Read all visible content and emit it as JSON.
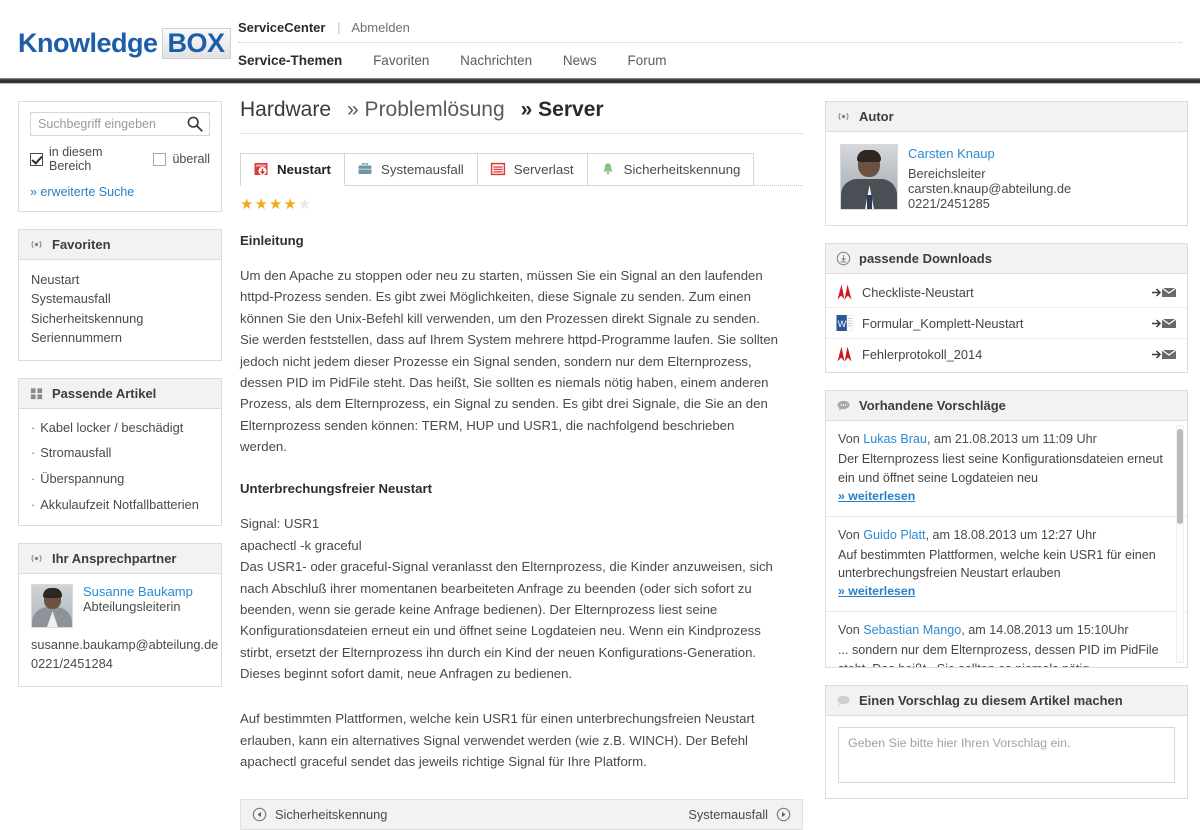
{
  "brand": {
    "name_1": "Knowledge",
    "name_2": "BOX",
    "color": "#1c5ea8"
  },
  "topnav": {
    "row1": {
      "active": "ServiceCenter",
      "sep": "|",
      "link": "Abmelden"
    },
    "row2": [
      {
        "label": "Service-Themen",
        "active": true
      },
      {
        "label": "Favoriten",
        "active": false
      },
      {
        "label": "Nachrichten",
        "active": false
      },
      {
        "label": "News",
        "active": false
      },
      {
        "label": "Forum",
        "active": false
      }
    ]
  },
  "search": {
    "placeholder": "Suchbegriff eingeben",
    "value": "",
    "icon": "search-icon",
    "scope_area_label": "in diesem Bereich",
    "scope_area_checked": true,
    "scope_all_label": "überall",
    "scope_all_checked": false,
    "advanced_label": "» erweiterte Suche"
  },
  "sidebar": {
    "favorites": {
      "icon": "radio-waves-icon",
      "title": "Favoriten",
      "items": [
        "Neustart",
        "Systemausfall",
        "Sicherheitskennung",
        "Seriennummern"
      ]
    },
    "related": {
      "icon": "grid-icon",
      "title": "Passende Artikel",
      "items": [
        "Kabel locker / beschädigt",
        "Stromausfall",
        "Überspannung",
        "Akkulaufzeit Notfallbatterien"
      ]
    },
    "contact": {
      "icon": "radio-waves-icon",
      "title": "Ihr Ansprechpartner",
      "name": "Susanne Baukamp",
      "role": "Abteilungsleiterin",
      "email": "susanne.baukamp@abteilung.de",
      "phone": "0221/2451284"
    }
  },
  "breadcrumb": {
    "root": "Hardware",
    "middle": "» Problemlösung",
    "current": "» Server"
  },
  "tabs": [
    {
      "label": "Neustart",
      "icon": "restart-server-icon",
      "active": true
    },
    {
      "label": "Systemausfall",
      "icon": "briefcase-icon",
      "active": false
    },
    {
      "label": "Serverlast",
      "icon": "server-load-icon",
      "active": false
    },
    {
      "label": "Sicherheitskennung",
      "icon": "bell-icon",
      "active": false
    }
  ],
  "rating": {
    "value": 4,
    "max": 5,
    "on_color": "#f0ab1d",
    "off_color": "#e9e9e9"
  },
  "article": {
    "heading_1": "Einleitung",
    "paragraph_1": "Um den Apache zu stoppen oder neu zu starten, müssen Sie ein Signal an den laufenden httpd-Prozess senden. Es gibt zwei Möglichkeiten, diese Signale zu senden. Zum einen können Sie den Unix-Befehl kill verwenden, um den Prozessen direkt Signale zu senden. Sie werden feststellen, dass auf Ihrem System mehrere httpd-Programme laufen. Sie sollten jedoch nicht jedem dieser Prozesse ein Signal senden, sondern nur dem Elternprozess, dessen PID im PidFile steht. Das heißt, Sie sollten es niemals nötig haben, einem anderen Prozess, als dem Elternprozess, ein Signal zu senden. Es gibt drei Signale, die Sie an den Elternprozess senden können: TERM, HUP und USR1, die nachfolgend beschrieben werden.",
    "heading_2": "Unterbrechungsfreier Neustart",
    "paragraph_2": "Signal: USR1\napachectl -k graceful\nDas USR1- oder graceful-Signal veranlasst den Elternprozess, die Kinder anzuweisen, sich nach Abschluß ihrer momentanen bearbeiteten Anfrage zu beenden (oder sich sofort zu beenden, wenn sie gerade keine Anfrage bedienen). Der Elternprozess liest seine Konfigurationsdateien erneut ein und öffnet seine Logdateien neu. Wenn ein Kindprozess stirbt, ersetzt der Elternprozess ihn durch ein Kind der neuen Konfigurations-Generation. Dieses beginnt sofort damit, neue Anfragen zu bedienen.",
    "paragraph_3": "Auf bestimmten Plattformen, welche kein USR1 für einen unterbrechungsfreien Neustart erlauben, kann ein alternatives Signal verwendet werden (wie z.B. WINCH). Der Befehl apachectl graceful sendet das jeweils richtige Signal für Ihre Platform."
  },
  "pager": {
    "prev_label": "Sicherheitskennung",
    "prev_icon": "circle-left-arrow-icon",
    "next_label": "Systemausfall",
    "next_icon": "circle-right-arrow-icon"
  },
  "author": {
    "icon": "radio-waves-icon",
    "title": "Autor",
    "name": "Carsten Knaup",
    "role": "Bereichsleiter",
    "email": "carsten.knaup@abteilung.de",
    "phone": "0221/2451285"
  },
  "downloads": {
    "icon": "download-circle-icon",
    "title": "passende Downloads",
    "items": [
      {
        "name": "Checkliste-Neustart",
        "filetype": "pdf-icon",
        "action_icon": "send-arrow-icon"
      },
      {
        "name": "Formular_Komplett-Neustart",
        "filetype": "word-icon",
        "action_icon": "send-arrow-icon"
      },
      {
        "name": "Fehlerprotokoll_2014",
        "filetype": "pdf-icon",
        "action_icon": "send-arrow-icon"
      }
    ]
  },
  "suggestions": {
    "icon": "chat-bubble-icon",
    "title": "Vorhandene Vorschläge",
    "more_label": "» weiterlesen",
    "items": [
      {
        "prefix": "Von ",
        "author": "Lukas Brau",
        "meta": ", am 21.08.2013 um 11:09 Uhr",
        "text": "Der Elternprozess liest seine Konfigurationsdateien erneut ein und öffnet seine Logdateien neu"
      },
      {
        "prefix": "Von ",
        "author": "Guido Platt",
        "meta": ", am 18.08.2013 um 12:27 Uhr",
        "text": "Auf bestimmten Plattformen, welche kein USR1 für einen unterbrechungsfreien Neustart erlauben"
      },
      {
        "prefix": "Von ",
        "author": "Sebastian Mango",
        "meta": ", am 14.08.2013 um 15:10Uhr",
        "text": "... sondern nur dem Elternprozess, dessen PID im PidFile steht. Das heißt , Sie sollten es niemals nötig ..."
      }
    ]
  },
  "new_suggestion": {
    "icon": "chat-bubble-icon",
    "title": "Einen Vorschlag zu diesem Artikel machen",
    "placeholder": "Geben Sie bitte hier Ihren Vorschlag ein.",
    "value": ""
  }
}
